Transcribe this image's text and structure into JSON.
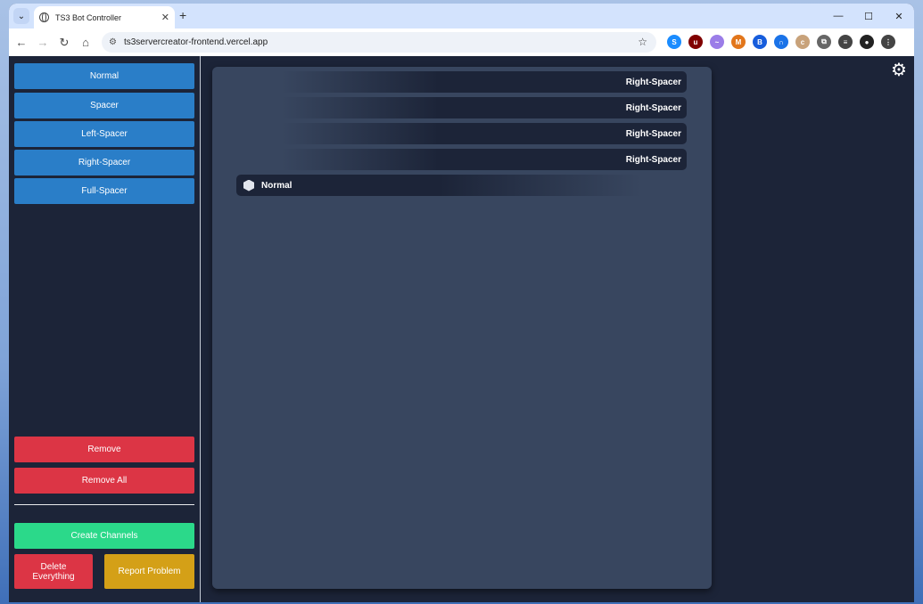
{
  "browser": {
    "tab_title": "TS3 Bot Controller",
    "tab_close": "✕",
    "new_tab": "+",
    "url": "ts3servercreator-frontend.vercel.app",
    "window_controls": {
      "minimize": "—",
      "maximize": "☐",
      "close": "✕"
    },
    "nav": {
      "back": "←",
      "forward": "→",
      "reload": "↻",
      "home": "⌂"
    },
    "extensions": [
      {
        "name": "shazam-icon",
        "color": "#1a8cff",
        "glyph": "S"
      },
      {
        "name": "ublock-icon",
        "color": "#800000",
        "glyph": "u"
      },
      {
        "name": "ext-purple-icon",
        "color": "#9b7de8",
        "glyph": "~"
      },
      {
        "name": "metamask-icon",
        "color": "#e2761b",
        "glyph": "M"
      },
      {
        "name": "bitwarden-icon",
        "color": "#175ddc",
        "glyph": "B"
      },
      {
        "name": "ext-arc-icon",
        "color": "#1a73e8",
        "glyph": "∩"
      },
      {
        "name": "ext-cookie-icon",
        "color": "#c8a27a",
        "glyph": "c"
      },
      {
        "name": "extensions-icon",
        "color": "#666666",
        "glyph": "⧉"
      },
      {
        "name": "reading-list-icon",
        "color": "#444444",
        "glyph": "≡"
      },
      {
        "name": "profile-avatar-icon",
        "color": "#222222",
        "glyph": "●"
      },
      {
        "name": "menu-icon",
        "color": "#444444",
        "glyph": "⋮"
      }
    ]
  },
  "sidebar": {
    "channel_types": [
      "Normal",
      "Spacer",
      "Left-Spacer",
      "Right-Spacer",
      "Full-Spacer"
    ],
    "remove_label": "Remove",
    "remove_all_label": "Remove All",
    "create_label": "Create Channels",
    "delete_label": "Delete\nEverything",
    "report_label": "Report Problem"
  },
  "channels": [
    {
      "type": "right",
      "label": "Right-Spacer"
    },
    {
      "type": "right",
      "label": "Right-Spacer"
    },
    {
      "type": "right",
      "label": "Right-Spacer"
    },
    {
      "type": "right",
      "label": "Right-Spacer"
    },
    {
      "type": "normal",
      "label": "Normal"
    }
  ],
  "colors": {
    "app_bg": "#1c2438",
    "panel_bg": "#38465f",
    "primary": "#2a7ec8",
    "danger": "#dc3545",
    "success": "#2bd98a",
    "warning": "#d4a017"
  }
}
